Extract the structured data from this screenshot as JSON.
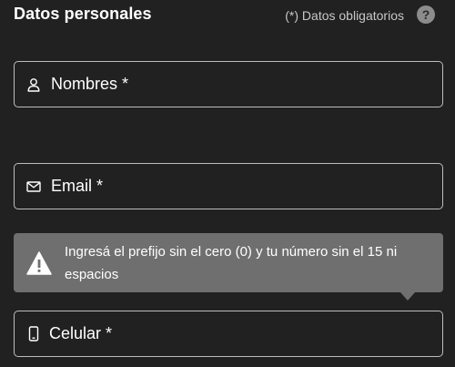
{
  "header": {
    "title": "Datos personales",
    "required_note": "(*) Datos obligatorios",
    "help_label": "?"
  },
  "fields": [
    {
      "label": "Nombres *",
      "icon": "person-icon",
      "value": ""
    },
    {
      "label": "Email *",
      "icon": "envelope-icon",
      "value": ""
    },
    {
      "label": "Celular *",
      "icon": "mobile-phone-icon",
      "value": ""
    }
  ],
  "tooltip": {
    "icon": "warning-icon",
    "text": "Ingresá el prefijo sin el cero (0) y tu número sin el 15 ni espacios"
  },
  "colors": {
    "background": "#212121",
    "field_border": "#bdbdbd",
    "tooltip_bg": "#6f6f6f",
    "help_bg": "#8c8c8c"
  }
}
